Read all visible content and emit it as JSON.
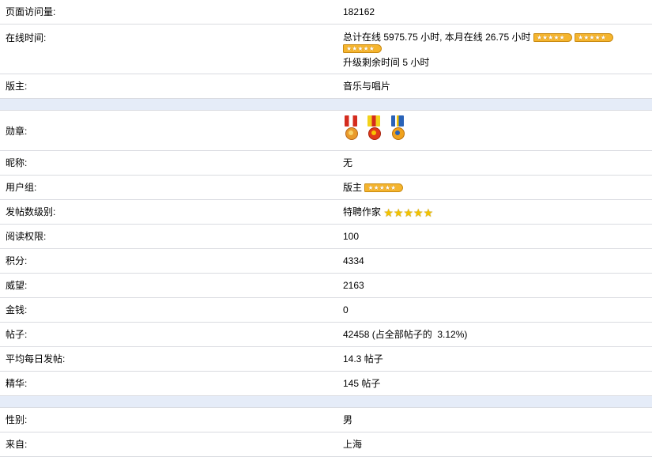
{
  "profile": {
    "page_views": {
      "label": "页面访问量:",
      "value": "182162"
    },
    "online_time": {
      "label": "在线时间:",
      "total_label": "总计在线",
      "total_value": "5975.75 小时,",
      "month_label": "本月在线",
      "month_value": "26.75 小时",
      "upgrade_label": "升级剩余时间",
      "upgrade_value": "5 小时"
    },
    "moderator": {
      "label": "版主:",
      "forum": "音乐与唱片"
    },
    "medals": {
      "label": "勋章:",
      "icons": [
        "gold-medal-icon",
        "star-medal-icon",
        "blue-medal-icon"
      ]
    },
    "nickname": {
      "label": "昵称:",
      "value": "无"
    },
    "user_group": {
      "label": "用户组:",
      "value": "版主"
    },
    "post_level": {
      "label": "发帖数级别:",
      "value": "特聘作家",
      "stars": 5
    },
    "read_permission": {
      "label": "阅读权限:",
      "value": "100"
    },
    "points": {
      "label": "积分:",
      "value": "4334"
    },
    "prestige": {
      "label": "威望:",
      "value": "2163"
    },
    "money": {
      "label": "金钱:",
      "value": "0"
    },
    "posts": {
      "label": "帖子:",
      "value": "42458 (占全部帖子的  3.12%)"
    },
    "avg_daily_posts": {
      "label": "平均每日发帖:",
      "value": "14.3 帖子"
    },
    "digest": {
      "label": "精华:",
      "value": "145 帖子"
    },
    "gender": {
      "label": "性别:",
      "value": "男"
    },
    "from": {
      "label": "来自:",
      "value": "上海"
    }
  },
  "colors": {
    "separator": "#e5ecf8",
    "border": "#d9dbe0",
    "rank_bar": "#f5b52e",
    "star": "#f2c200"
  }
}
